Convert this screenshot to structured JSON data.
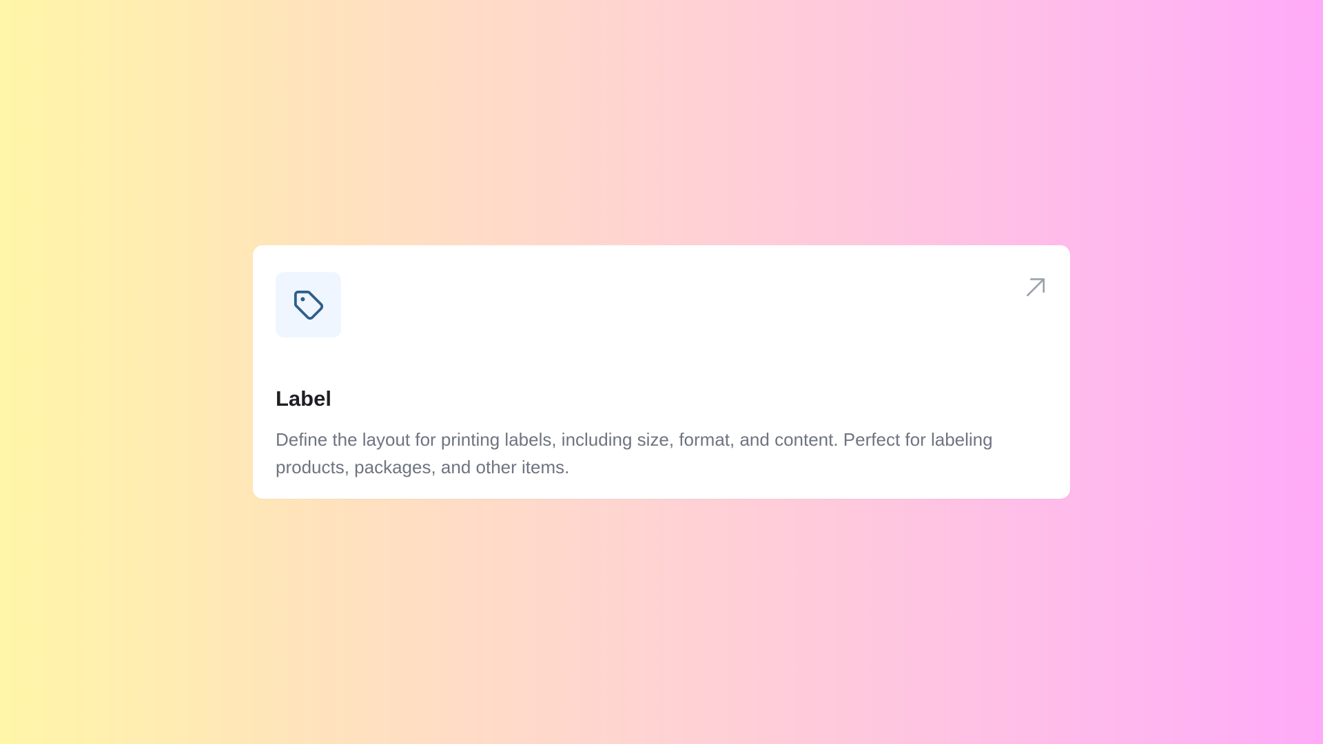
{
  "card": {
    "icon": "tag-icon",
    "link_icon": "arrow-up-right-icon",
    "title": "Label",
    "description": "Define the layout for printing labels, including size, format, and content. Perfect for labeling products, packages, and other items."
  },
  "colors": {
    "background_start": "#fff6a8",
    "background_end": "#ffaaf8",
    "card_bg": "#ffffff",
    "icon_tile_bg": "#eff6ff",
    "icon_color": "#2f5f8a",
    "title_color": "#1f2024",
    "description_color": "#6e7480",
    "arrow_color": "#9aa1ab"
  }
}
